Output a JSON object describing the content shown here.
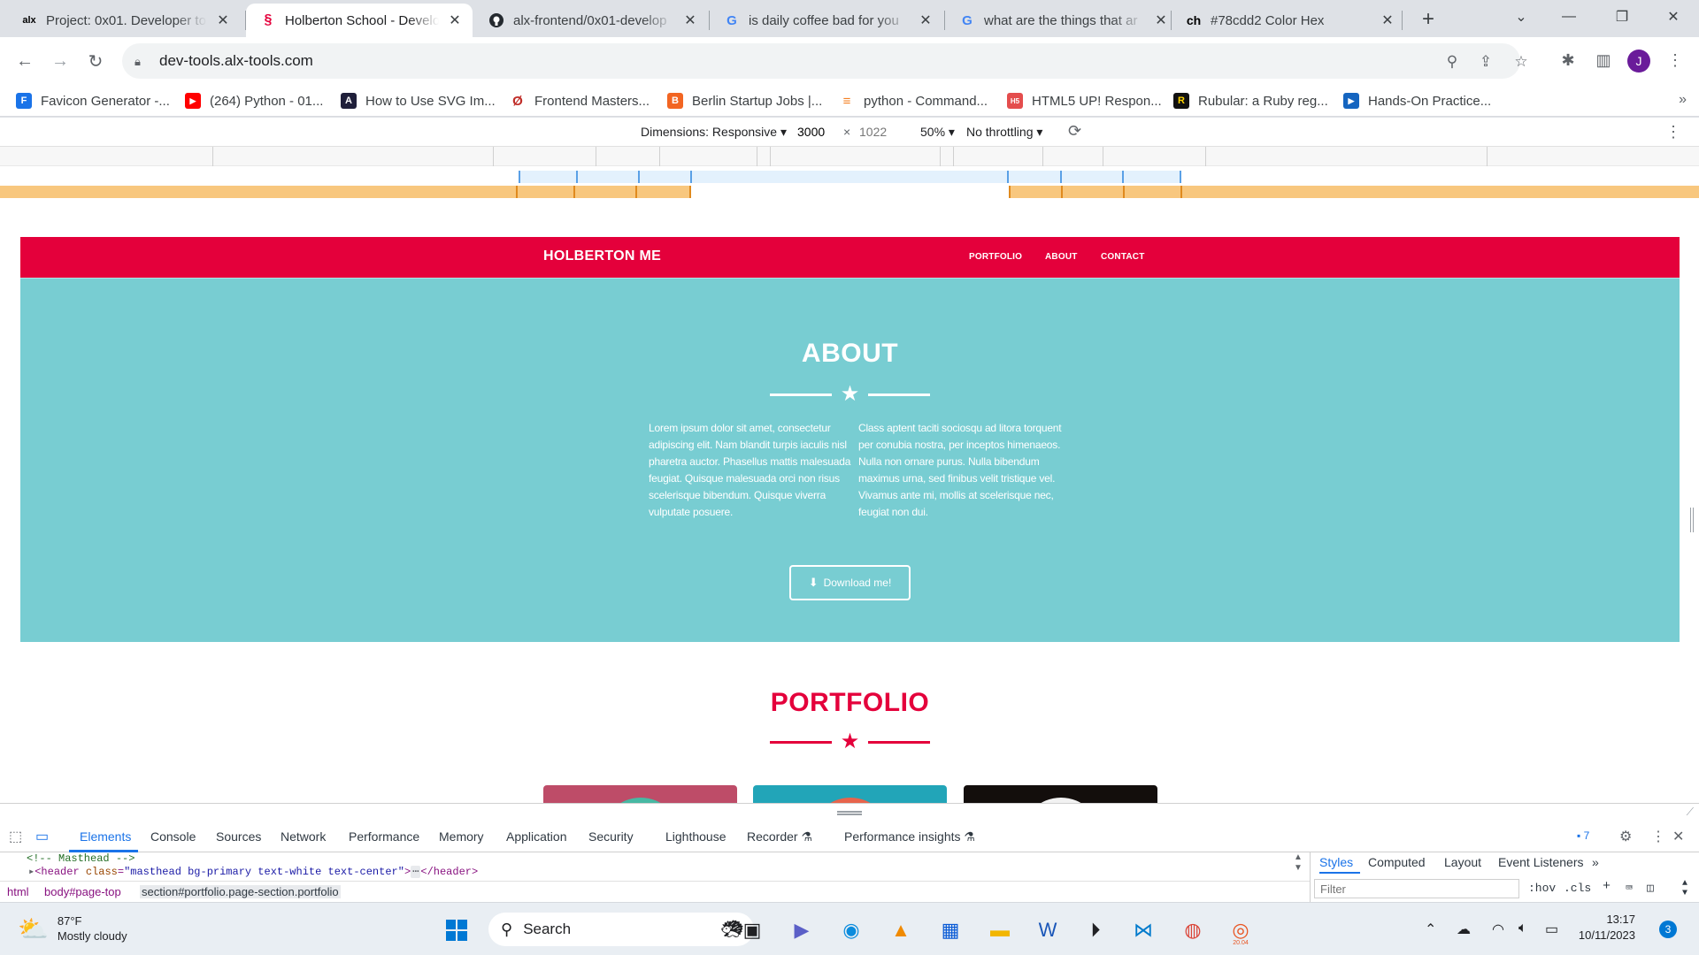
{
  "browser": {
    "tabs": [
      {
        "title": "Project: 0x01. Developer to",
        "favicon": "alx-icon",
        "active": false
      },
      {
        "title": "Holberton School - Develo",
        "favicon": "holberton-icon",
        "active": true
      },
      {
        "title": "alx-frontend/0x01-develop",
        "favicon": "github-icon",
        "active": false
      },
      {
        "title": "is daily coffee bad for you",
        "favicon": "google-icon",
        "active": false
      },
      {
        "title": "what are the things that ar",
        "favicon": "google-icon",
        "active": false
      },
      {
        "title": "#78cdd2 Color Hex",
        "favicon": "colorhex-icon",
        "active": false
      }
    ],
    "favicon_text": {
      "alx": "alx",
      "colorhex": "ch",
      "google": "G"
    },
    "url": "dev-tools.alx-tools.com",
    "profile_initial": "J",
    "bookmarks": [
      {
        "label": "Favicon Generator -...",
        "icon": "favicon-generator-icon",
        "color": "#1a73e8",
        "text": "F"
      },
      {
        "label": "(264) Python - 01...",
        "icon": "youtube-icon",
        "color": "#ff0000",
        "text": "▶"
      },
      {
        "label": "How to Use SVG Im...",
        "icon": "svg-site-icon",
        "color": "#1f1f3a",
        "text": "A"
      },
      {
        "label": "Frontend Masters...",
        "icon": "frontend-masters-icon",
        "color": "#c02d28",
        "text": "Ø"
      },
      {
        "label": "Berlin Startup Jobs |...",
        "icon": "berlin-startup-icon",
        "color": "#f26522",
        "text": "B"
      },
      {
        "label": "python - Command...",
        "icon": "stackoverflow-icon",
        "color": "#f48024",
        "text": "≡"
      },
      {
        "label": "HTML5 UP! Respon...",
        "icon": "html5up-icon",
        "color": "#e44d4d",
        "text": "H5"
      },
      {
        "label": "Rubular: a Ruby reg...",
        "icon": "rubular-icon",
        "color": "#111111",
        "text": "R"
      },
      {
        "label": "Hands-On Practice...",
        "icon": "hands-on-icon",
        "color": "#1565c0",
        "text": "▶"
      }
    ]
  },
  "device_toolbar": {
    "dimensions_label": "Dimensions: Responsive",
    "width": "3000",
    "times": "×",
    "height": "1022",
    "zoom": "50%",
    "throttling": "No throttling"
  },
  "site": {
    "brand": "HOLBERTON ME",
    "nav": [
      "PORTFOLIO",
      "ABOUT",
      "CONTACT"
    ],
    "about_title": "ABOUT",
    "about_left": "Lorem ipsum dolor sit amet, consectetur adipiscing elit. Nam blandit turpis iaculis nisl pharetra auctor. Phasellus mattis malesuada feugiat. Quisque malesuada orci non risus scelerisque bibendum. Quisque viverra vulputate posuere.",
    "about_right": "Class aptent taciti sociosqu ad litora torquent per conubia nostra, per inceptos himenaeos. Nulla non ornare purus. Nulla bibendum maximus urna, sed finibus velit tristique vel. Vivamus ante mi, mollis at scelerisque nec, feugiat non dui.",
    "download_label": "Download me!",
    "portfolio_title": "PORTFOLIO",
    "colors": {
      "primary": "#e4003b",
      "secondary": "#78cdd2"
    },
    "cards": [
      {
        "bg": "#be4c68",
        "circle": "#47b8a3"
      },
      {
        "bg": "#22a5b8",
        "circle": "#e7644c"
      },
      {
        "bg": "#130e0c",
        "circle": "#f2f2f2"
      }
    ]
  },
  "devtools": {
    "tabs": [
      "Elements",
      "Console",
      "Sources",
      "Network",
      "Performance",
      "Memory",
      "Application",
      "Security",
      "Lighthouse",
      "Recorder",
      "Performance insights"
    ],
    "issues_count": "7",
    "code_comment": "<!-- Masthead -->",
    "code_tag_open": "<header",
    "code_attr": "class",
    "code_value": "\"masthead bg-primary text-white text-center\"",
    "code_close": "</header>",
    "breadcrumbs": [
      "html",
      "body#page-top",
      "section#portfolio.page-section.portfolio"
    ],
    "styles_tabs": [
      "Styles",
      "Computed",
      "Layout",
      "Event Listeners"
    ],
    "filter_placeholder": "Filter",
    "hov": ":hov",
    "cls": ".cls"
  },
  "taskbar": {
    "temperature": "87°F",
    "weather": "Mostly cloudy",
    "search": "Search",
    "time": "13:17",
    "date": "10/11/2023",
    "notifications": "3",
    "ubuntu_label": "20.04"
  }
}
